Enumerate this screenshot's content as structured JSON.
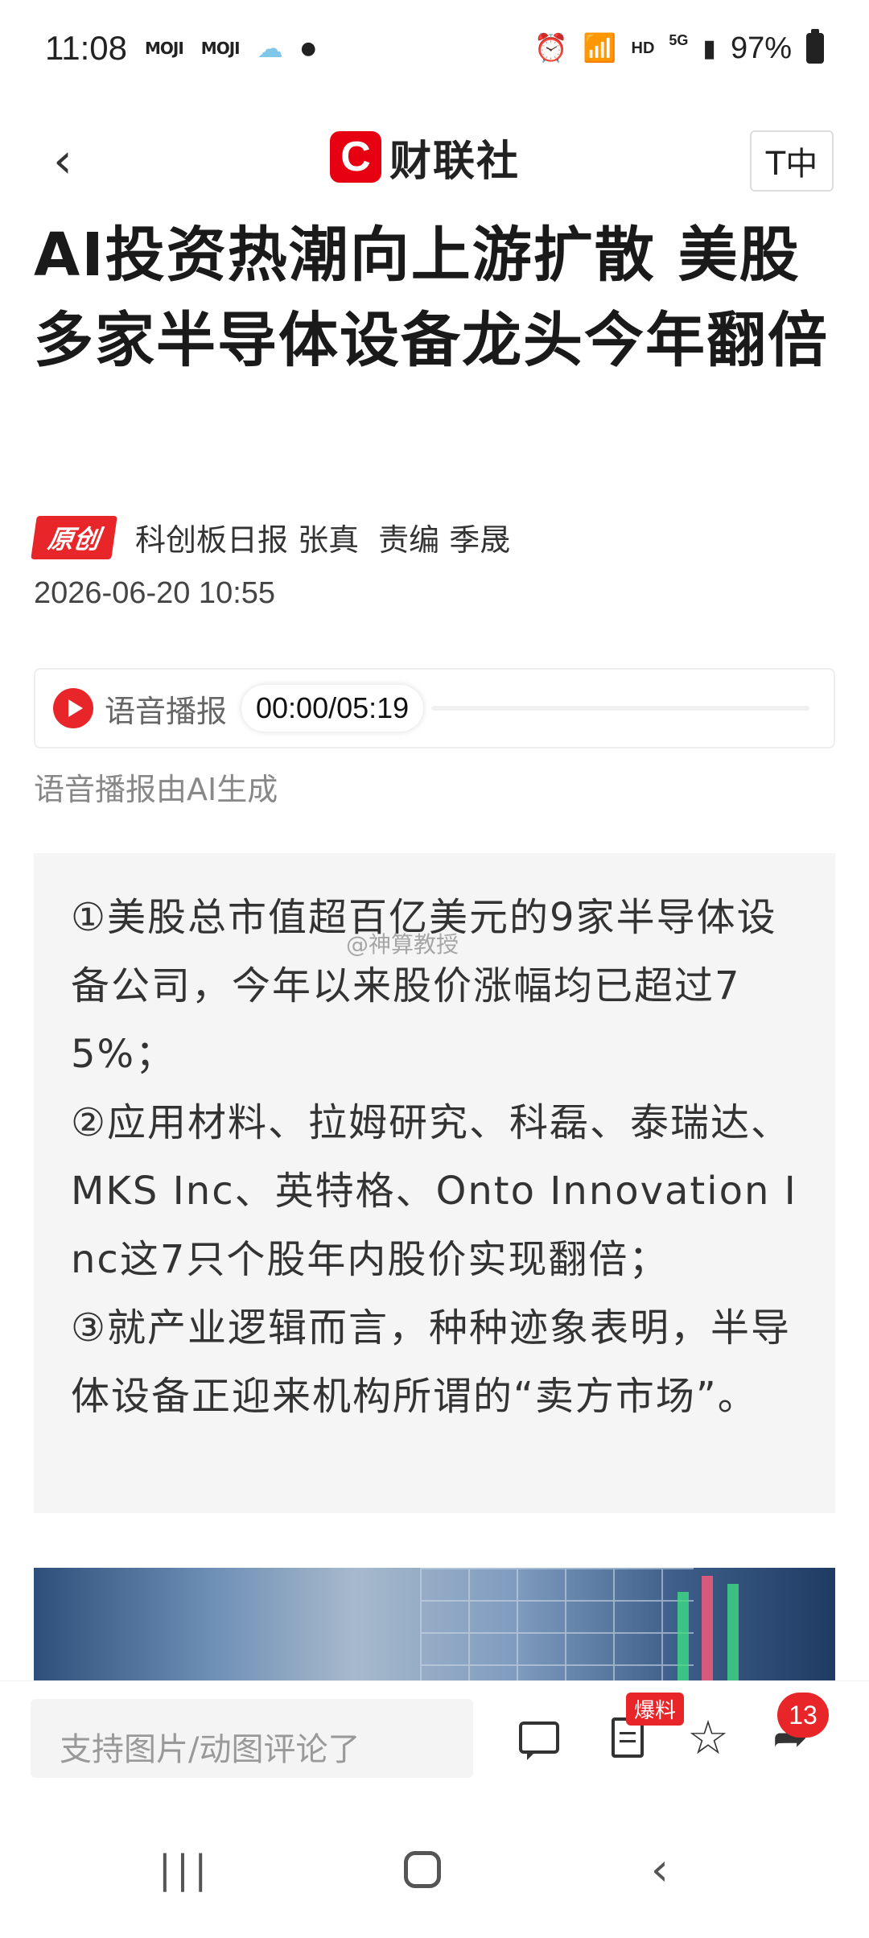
{
  "status_bar": {
    "time": "11:08",
    "app1": "MOJI",
    "app2": "MOJI",
    "hd": "HD",
    "network": "5G",
    "battery": "97%"
  },
  "header": {
    "logo_mark": "C",
    "logo_text": "财联社",
    "font_toggle": "T中"
  },
  "article": {
    "title": "AI投资热潮向上游扩散 美股多家半导体设备龙头今年翻倍",
    "badge": "原创",
    "source": "科创板日报 张真",
    "editor": "责编 季晟",
    "date": "2026-06-20 10:55"
  },
  "audio": {
    "label": "语音播报",
    "time": "00:00/05:19",
    "note": "语音播报由AI生成"
  },
  "summary": {
    "point1": "①美股总市值超百亿美元的9家半导体设备公司，今年以来股价涨幅均已超过75%；",
    "point2": "②应用材料、拉姆研究、科磊、泰瑞达、MKS Inc、英特格、Onto Innovation Inc这7只个股年内股价实现翻倍；",
    "point3": "③就产业逻辑而言，种种迹象表明，半导体设备正迎来机构所谓的“卖方市场”。",
    "watermark": "@神算教授"
  },
  "bottom_bar": {
    "comment_placeholder": "支持图片/动图评论了",
    "hot_badge": "爆料",
    "share_count": "13"
  },
  "colors": {
    "brand_red": "#e60012",
    "accent_red": "#e8262a"
  }
}
